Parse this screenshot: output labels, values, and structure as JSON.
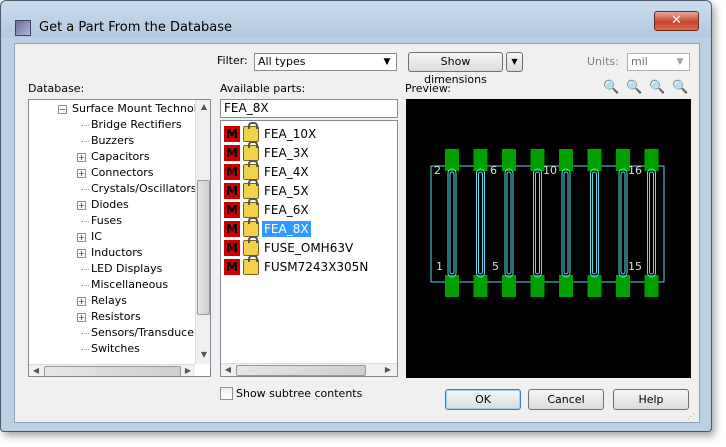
{
  "window": {
    "title": "Get a Part From the Database",
    "close_label": "✕"
  },
  "filter": {
    "label": "Filter:",
    "value": "All types"
  },
  "toolbar": {
    "show_dimensions_label": "Show dimensions",
    "units_label": "Units:",
    "units_value": "mil"
  },
  "database": {
    "label": "Database:",
    "root": "Surface Mount Technolog",
    "items": [
      {
        "label": "Bridge Rectifiers",
        "expandable": false
      },
      {
        "label": "Buzzers",
        "expandable": false
      },
      {
        "label": "Capacitors",
        "expandable": true
      },
      {
        "label": "Connectors",
        "expandable": true
      },
      {
        "label": "Crystals/Oscillators",
        "expandable": false
      },
      {
        "label": "Diodes",
        "expandable": true
      },
      {
        "label": "Fuses",
        "expandable": false,
        "selected": true
      },
      {
        "label": "IC",
        "expandable": true
      },
      {
        "label": "Inductors",
        "expandable": true
      },
      {
        "label": "LED Displays",
        "expandable": false
      },
      {
        "label": "Miscellaneous",
        "expandable": false
      },
      {
        "label": "Relays",
        "expandable": true
      },
      {
        "label": "Resistors",
        "expandable": true
      },
      {
        "label": "Sensors/Transducers",
        "expandable": false
      },
      {
        "label": "Switches",
        "expandable": false
      }
    ]
  },
  "parts": {
    "label": "Available parts:",
    "search_value": "FEA_8X",
    "items": [
      {
        "name": "FEA_10X",
        "selected": false
      },
      {
        "name": "FEA_3X",
        "selected": false
      },
      {
        "name": "FEA_4X",
        "selected": false
      },
      {
        "name": "FEA_5X",
        "selected": false
      },
      {
        "name": "FEA_6X",
        "selected": false
      },
      {
        "name": "FEA_8X",
        "selected": true
      },
      {
        "name": "FUSE_OMH63V",
        "selected": false
      },
      {
        "name": "FUSM7243X305N",
        "selected": false
      }
    ]
  },
  "preview": {
    "label": "Preview:",
    "pin_labels_top": [
      "2",
      "6",
      "10",
      "16"
    ],
    "pin_labels_bottom": [
      "1",
      "5",
      "15"
    ],
    "pad_color": "#00a000",
    "outline_color": "#5fd7e6"
  },
  "footer": {
    "subtree_label": "Show subtree contents",
    "ok_label": "OK",
    "cancel_label": "Cancel",
    "help_label": "Help"
  }
}
